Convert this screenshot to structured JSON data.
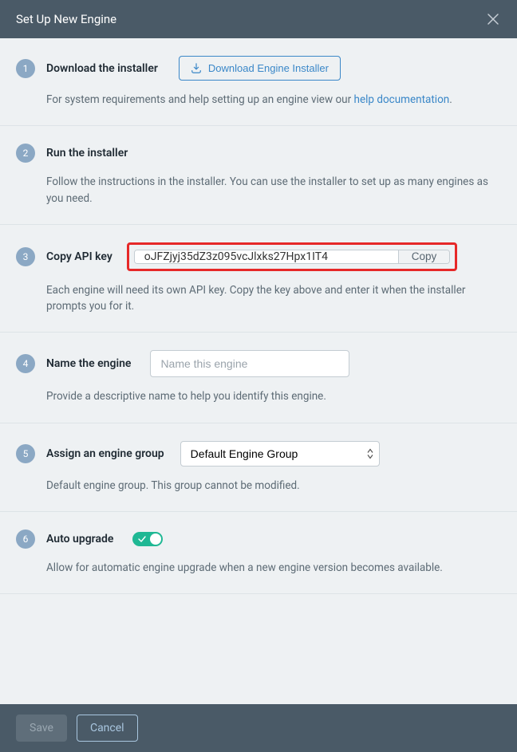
{
  "header": {
    "title": "Set Up New Engine"
  },
  "steps": {
    "s1": {
      "num": "1",
      "title": "Download the installer",
      "button": "Download Engine Installer",
      "desc_pre": "For system requirements and help setting up an engine view our ",
      "link": "help documentation",
      "desc_post": "."
    },
    "s2": {
      "num": "2",
      "title": "Run the installer",
      "desc": "Follow the instructions in the installer. You can use the installer to set up as many engines as you need."
    },
    "s3": {
      "num": "3",
      "title": "Copy API key",
      "api_key": "oJFZjyj35dZ3z095vcJlxks27Hpx1IT4",
      "copy": "Copy",
      "desc": "Each engine will need its own API key. Copy the key above and enter it when the installer prompts you for it."
    },
    "s4": {
      "num": "4",
      "title": "Name the engine",
      "placeholder": "Name this engine",
      "desc": "Provide a descriptive name to help you identify this engine."
    },
    "s5": {
      "num": "5",
      "title": "Assign an engine group",
      "selected": "Default Engine Group",
      "desc": "Default engine group. This group cannot be modified."
    },
    "s6": {
      "num": "6",
      "title": "Auto upgrade",
      "desc": "Allow for automatic engine upgrade when a new engine version becomes available."
    }
  },
  "footer": {
    "save": "Save",
    "cancel": "Cancel"
  }
}
